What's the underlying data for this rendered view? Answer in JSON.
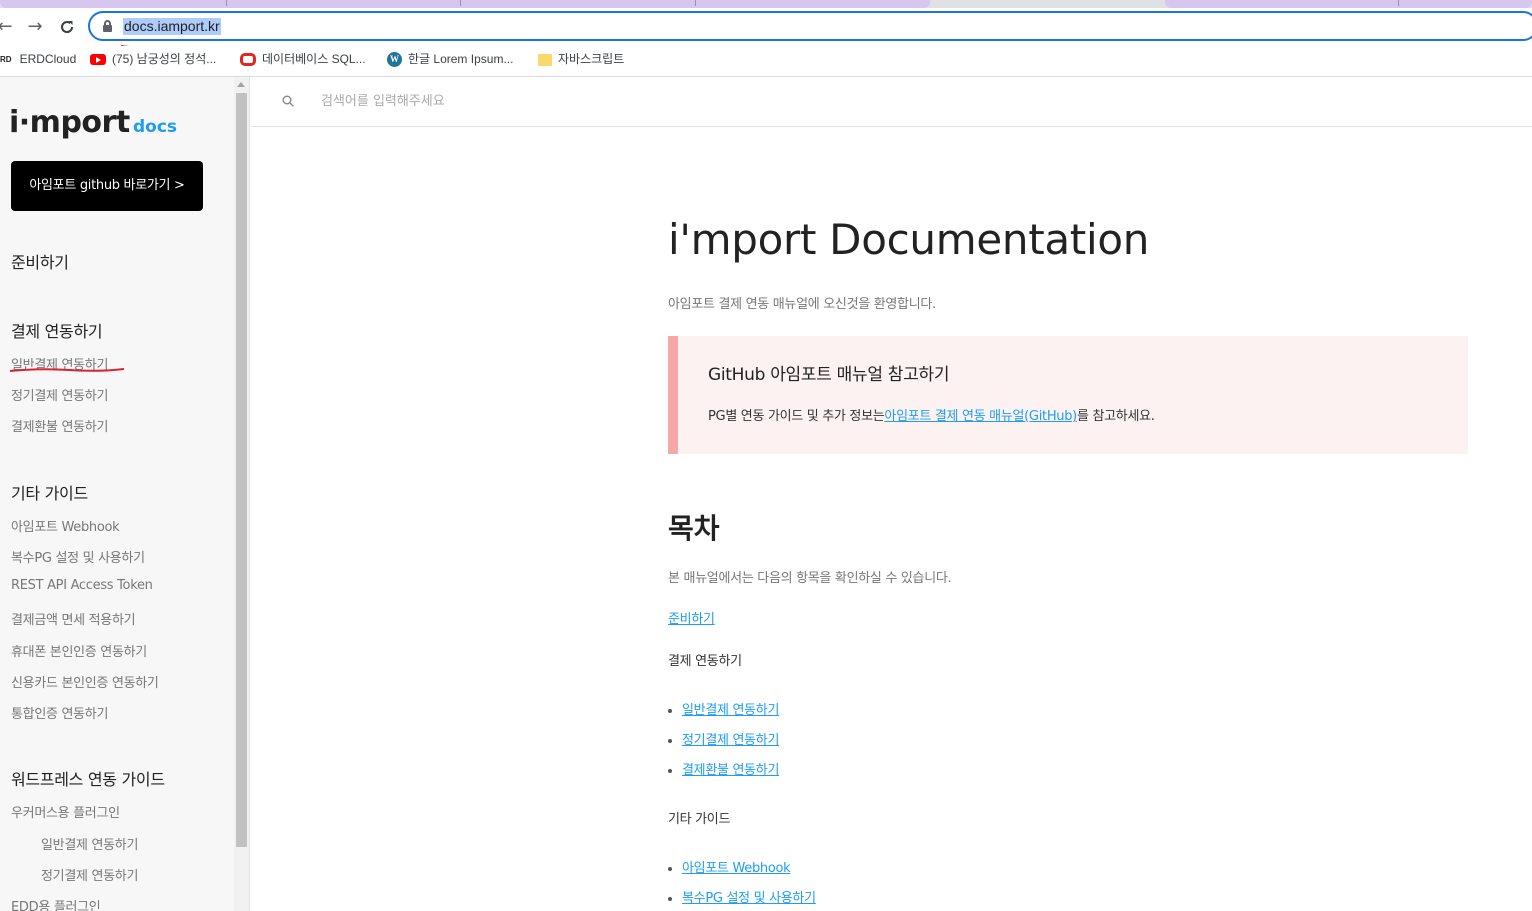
{
  "browser": {
    "url": "docs.iamport.kr",
    "bookmarks": [
      {
        "label": "ERDCloud",
        "icon": "erd-icon"
      },
      {
        "label": "(75) 남궁성의 정석...",
        "icon": "youtube-icon"
      },
      {
        "label": "데이터베이스 SQL...",
        "icon": "oracle-icon"
      },
      {
        "label": "한글 Lorem Ipsum...",
        "icon": "wordpress-icon"
      },
      {
        "label": "자바스크립트",
        "icon": "folder-icon"
      }
    ],
    "erd_prefix": "RD"
  },
  "sidebar": {
    "logo_main": "i·mport",
    "logo_sub": "docs",
    "github_button": "아임포트 github 바로가기 >",
    "sections": [
      {
        "title": "준비하기",
        "items": []
      },
      {
        "title": "결제 연동하기",
        "items": [
          "일반결제 연동하기",
          "정기결제 연동하기",
          "결제환불 연동하기"
        ]
      },
      {
        "title": "기타 가이드",
        "items": [
          "아임포트 Webhook",
          "복수PG 설정 및 사용하기",
          "REST API Access Token",
          "결제금액 면세 적용하기",
          "휴대폰 본인인증 연동하기",
          "신용카드 본인인증 연동하기",
          "통합인증 연동하기"
        ]
      },
      {
        "title": "워드프레스 연동 가이드",
        "items": [
          "우커머스용 플러그인",
          "일반결제 연동하기",
          "정기결제 연동하기",
          "EDD용 플러그인"
        ]
      }
    ]
  },
  "search": {
    "placeholder": "검색어를 입력해주세요"
  },
  "main": {
    "title": "i'mport Documentation",
    "intro": "아임포트 결제 연동 매뉴얼에 오신것을 환영합니다.",
    "callout": {
      "title": "GitHub 아임포트 매뉴얼 참고하기",
      "text_before": "PG별 연동 가이드 및 추가 정보는",
      "link": "아임포트 결제 연동 매뉴얼(GitHub)",
      "text_after": "를 참고하세요."
    },
    "toc": {
      "title": "목차",
      "intro": "본 매뉴얼에서는 다음의 항목을 확인하실 수 있습니다.",
      "link_prepare": "준비하기",
      "section_payment": "결제 연동하기",
      "payment_items": [
        "일반결제 연동하기",
        "정기결제 연동하기",
        "결제환불 연동하기"
      ],
      "section_other": "기타 가이드",
      "other_items": [
        "아임포트 Webhook",
        "복수PG 설정 및 사용하기"
      ]
    }
  },
  "colors": {
    "accent": "#1e9df2",
    "callout_bg": "#fdf2f2",
    "callout_border": "#f7a7a7",
    "annotation": "#d8252f"
  }
}
